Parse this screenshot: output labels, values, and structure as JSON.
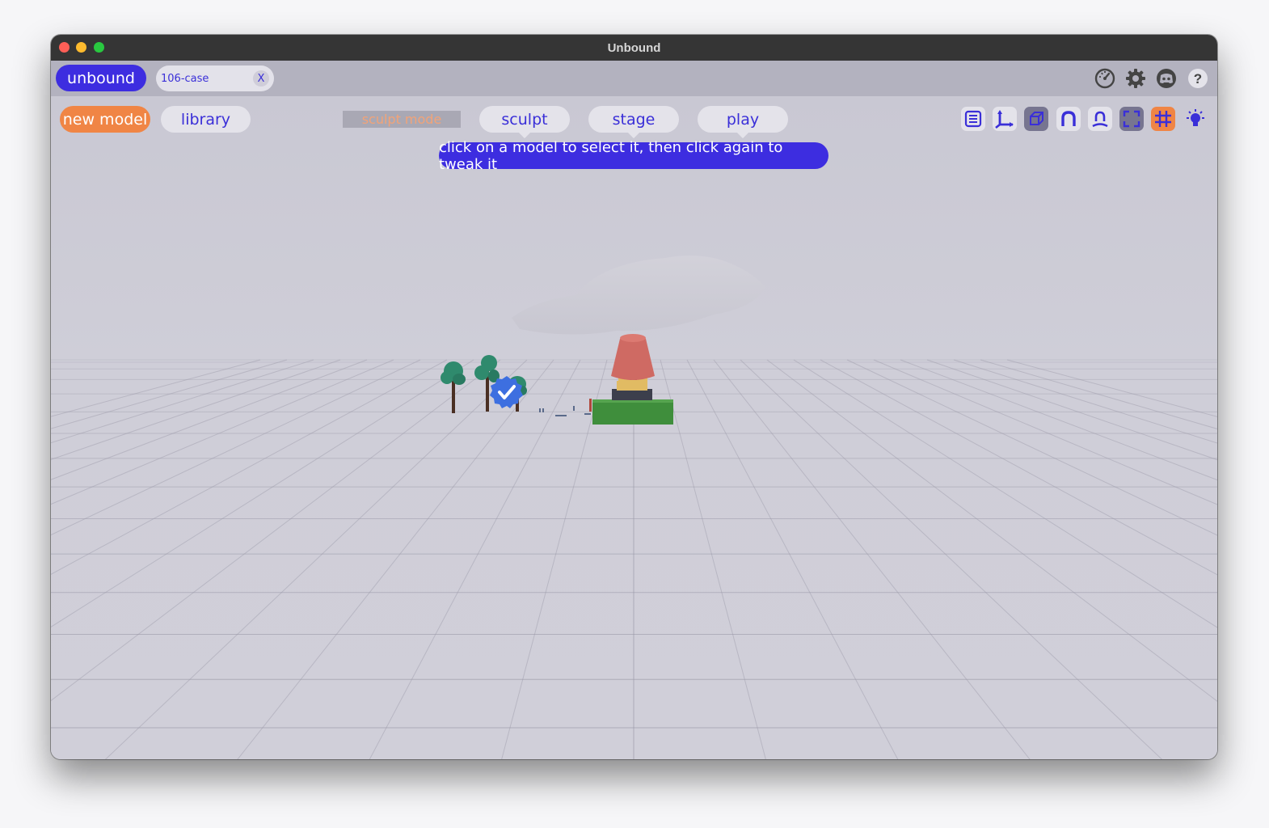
{
  "window": {
    "title": "Unbound"
  },
  "topbar": {
    "app_label": "unbound",
    "file_tab": {
      "name": "106-case",
      "close_label": "X"
    },
    "icons": [
      "performance-gauge-icon",
      "settings-gear-icon",
      "discord-icon",
      "help-icon"
    ]
  },
  "toolbar": {
    "new_model_label": "new model",
    "library_label": "library",
    "mode_label": "sculpt mode",
    "tabs": [
      {
        "label": "sculpt"
      },
      {
        "label": "stage"
      },
      {
        "label": "play"
      }
    ],
    "tools": [
      "outline-list-icon",
      "axes-icon",
      "cube-icon",
      "magnet-icon",
      "person-snap-icon",
      "frame-icon",
      "grid-icon",
      "light-icon"
    ]
  },
  "hint": {
    "text": "click on a model to select it, then click again to tweak it"
  },
  "colors": {
    "accent": "#3d2de0",
    "orange": "#f08545",
    "pill": "#e4e3ea",
    "viewport": "#c9c8d3"
  }
}
